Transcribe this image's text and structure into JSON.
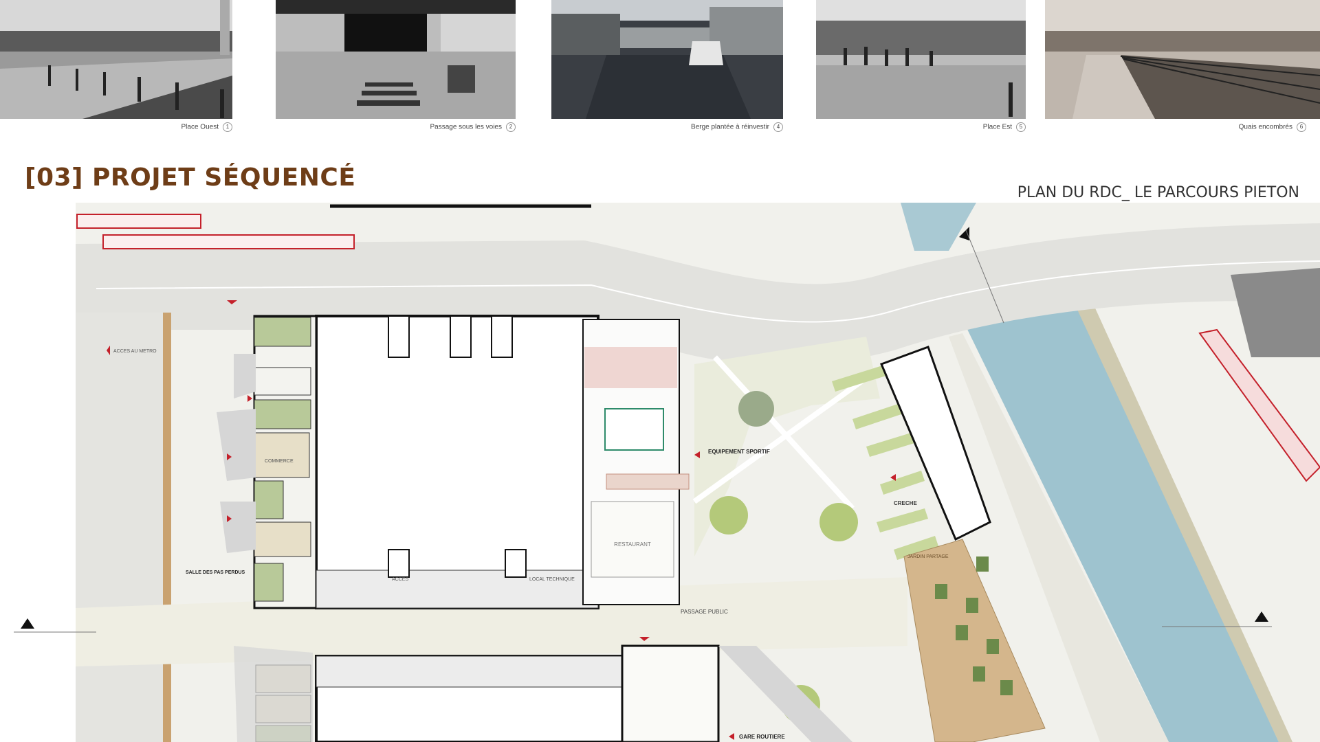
{
  "photos": [
    {
      "caption": "Place Ouest",
      "number": "1",
      "tone": "#7d7d7d"
    },
    {
      "caption": "Passage sous les voies",
      "number": "2",
      "tone": "#6c6c6c"
    },
    {
      "caption": "Berge plantée à réinvestir",
      "number": "4",
      "tone": "#5a6068"
    },
    {
      "caption": "Place Est",
      "number": "5",
      "tone": "#8a8a8a"
    },
    {
      "caption": "Quais encombrés",
      "number": "6",
      "tone": "#a09890"
    }
  ],
  "header": {
    "section_title": "[03] PROJET SÉQUENCÉ",
    "plan_title": "PLAN DU RDC_ LE PARCOURS PIETON"
  },
  "plan_labels": {
    "passage_public": "PASSAGE PUBLIC",
    "equipement_sportif": "EQUIPEMENT SPORTIF",
    "creche": "CRECHE",
    "salle_pas_perdus": "SALLE DES PAS PERDUS",
    "acces_metro": "ACCES AU METRO",
    "commerce": "COMMERCE",
    "local_technique": "LOCAL TECHNIQUE",
    "acces": "ACCES",
    "restaurant": "RESTAURANT",
    "gare_routiere": "GARE ROUTIERE",
    "jardin_partage": "JARDIN PARTAGE"
  },
  "colors": {
    "title_brown": "#6e3d17",
    "water": "#9ec3cf",
    "road": "#e2e2de",
    "path": "#efeee3",
    "green_strip": "#c8d89c",
    "deck": "#d4b68c",
    "marker_red": "#c4202a"
  }
}
